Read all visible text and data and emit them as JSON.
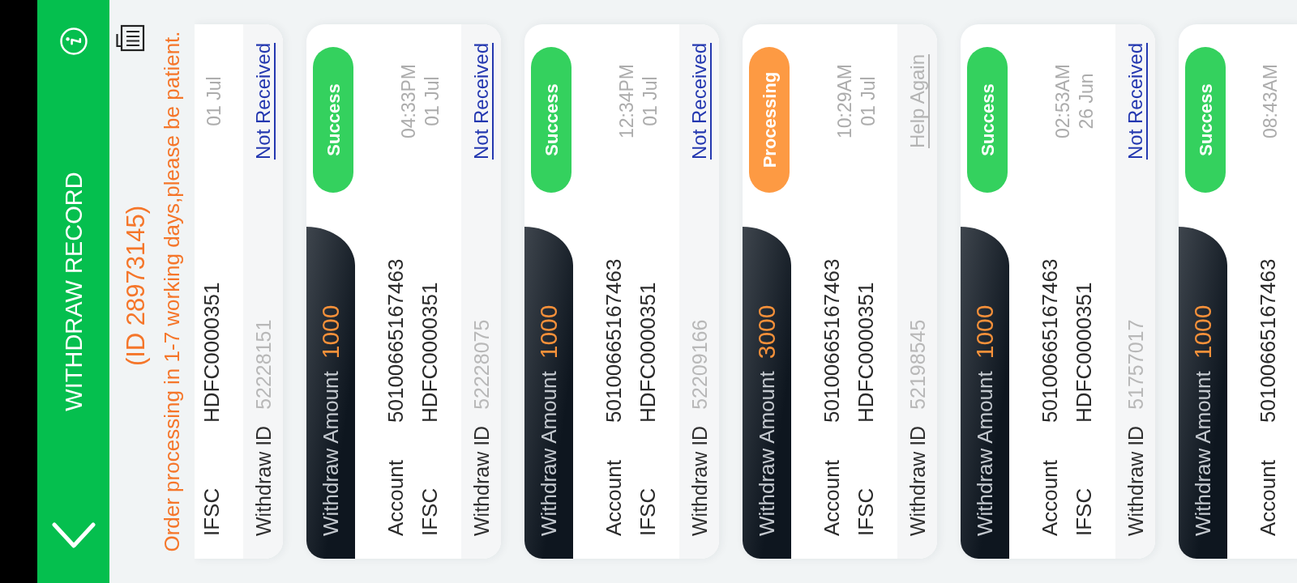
{
  "app_bar": {
    "title": "WITHDRAW RECORD"
  },
  "notice": {
    "id_text": "(ID 28973145)",
    "message": "Order processing in 1-7 working days,please be patient."
  },
  "records": [
    {
      "date": "01 Jul",
      "ifsc_label": "IFSC",
      "ifsc": "HDFC0000351",
      "withdraw_id_label": "Withdraw ID",
      "withdraw_id": "52228151",
      "action": {
        "label": "Not Received",
        "disabled": false
      }
    },
    {
      "amount_label": "Withdraw Amount",
      "amount": "1000",
      "status": {
        "label": "Success",
        "color": "#34d15e"
      },
      "account_label": "Account",
      "account": "50100665167463",
      "ifsc_label": "IFSC",
      "ifsc": "HDFC0000351",
      "time": "04:33PM",
      "date": "01 Jul",
      "withdraw_id_label": "Withdraw ID",
      "withdraw_id": "52228075",
      "action": {
        "label": "Not Received",
        "disabled": false
      }
    },
    {
      "amount_label": "Withdraw Amount",
      "amount": "1000",
      "status": {
        "label": "Success",
        "color": "#34d15e"
      },
      "account_label": "Account",
      "account": "50100665167463",
      "ifsc_label": "IFSC",
      "ifsc": "HDFC0000351",
      "time": "12:34PM",
      "date": "01 Jul",
      "withdraw_id_label": "Withdraw ID",
      "withdraw_id": "52209166",
      "action": {
        "label": "Not Received",
        "disabled": false
      }
    },
    {
      "amount_label": "Withdraw Amount",
      "amount": "3000",
      "status": {
        "label": "Processing",
        "color": "#fd9a43"
      },
      "account_label": "Account",
      "account": "50100665167463",
      "ifsc_label": "IFSC",
      "ifsc": "HDFC0000351",
      "time": "10:29AM",
      "date": "01 Jul",
      "withdraw_id_label": "Withdraw ID",
      "withdraw_id": "52198545",
      "action": {
        "label": "Help Again",
        "disabled": true
      }
    },
    {
      "amount_label": "Withdraw Amount",
      "amount": "1000",
      "status": {
        "label": "Success",
        "color": "#34d15e"
      },
      "account_label": "Account",
      "account": "50100665167463",
      "ifsc_label": "IFSC",
      "ifsc": "HDFC0000351",
      "time": "02:53AM",
      "date": "26 Jun",
      "withdraw_id_label": "Withdraw ID",
      "withdraw_id": "51757017",
      "action": {
        "label": "Not Received",
        "disabled": false
      }
    },
    {
      "amount_label": "Withdraw Amount",
      "amount": "1000",
      "status": {
        "label": "Success",
        "color": "#34d15e"
      },
      "account_label": "Account",
      "account": "50100665167463",
      "time": "08:43AM"
    }
  ]
}
